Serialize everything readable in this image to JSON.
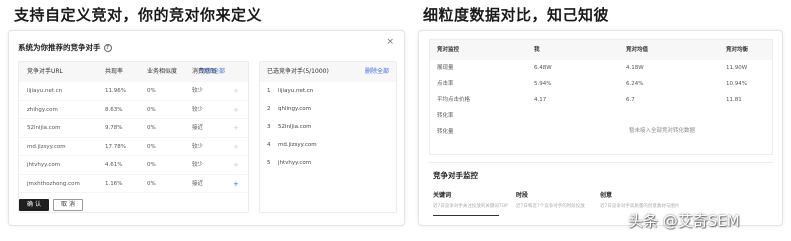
{
  "headline_left": "支持自定义竞对，你的竞对你来定义",
  "headline_right": "细粒度数据对比，知己知彼",
  "dialog": {
    "title": "系统为你推荐的竞争对手",
    "close": "×",
    "table": {
      "headers": [
        "竞争对手URL",
        "共现率",
        "业务相似度",
        "消费意图",
        "添加全部"
      ],
      "rows": [
        [
          "lijiayu.net.cn",
          "11.96%",
          "0%",
          "较少",
          "+"
        ],
        [
          "zhihgy.com",
          "8.63%",
          "0%",
          "较少",
          "+"
        ],
        [
          "52lnljia.com",
          "9.78%",
          "0%",
          "接近",
          "+"
        ],
        [
          "md.jizsyy.com",
          "17.78%",
          "0%",
          "较少",
          "+"
        ],
        [
          "jhtvhyy.com",
          "4.61%",
          "0%",
          "较少",
          "+"
        ],
        [
          "jmxhthozhong.com",
          "1.16%",
          "0%",
          "接近",
          "+"
        ]
      ]
    },
    "selected": {
      "title": "已选竞争对手(5/1000)",
      "delete_all": "删除全部",
      "items": [
        "lijiayu.net.cn",
        "qhlingy.com",
        "52lnljia.com",
        "md.jizsyy.com",
        "jhtvhyy.com"
      ]
    },
    "ok": "确 认",
    "cancel": "取 消"
  },
  "compare": {
    "headers": [
      "竞对监控",
      "我",
      "竞对均值",
      "竞对均衡"
    ],
    "rows": [
      [
        "展现量",
        "6.48W",
        "4.18W",
        "11.90W"
      ],
      [
        "点击率",
        "5.94%",
        "6.24%",
        "10.94%"
      ],
      [
        "平均点击价格",
        "4.17",
        "6.7",
        "11.81"
      ],
      [
        "转化率",
        "",
        "",
        ""
      ],
      [
        "转化量",
        "",
        "",
        ""
      ]
    ],
    "empty_note": "暂未接入全部竞对转化数据"
  },
  "monitor": {
    "title": "竞争对手监控",
    "cols": [
      {
        "label": "关键词",
        "desc": "近7日竞争对手关注投放的关键词TOP"
      },
      {
        "label": "时段",
        "desc": "近7日和近7个竞争对手的时段投放"
      },
      {
        "label": "创意",
        "desc": "近7日竞争对手高质量的创意素材与图片"
      }
    ]
  },
  "watermark": "头条 @艾奇SEM"
}
